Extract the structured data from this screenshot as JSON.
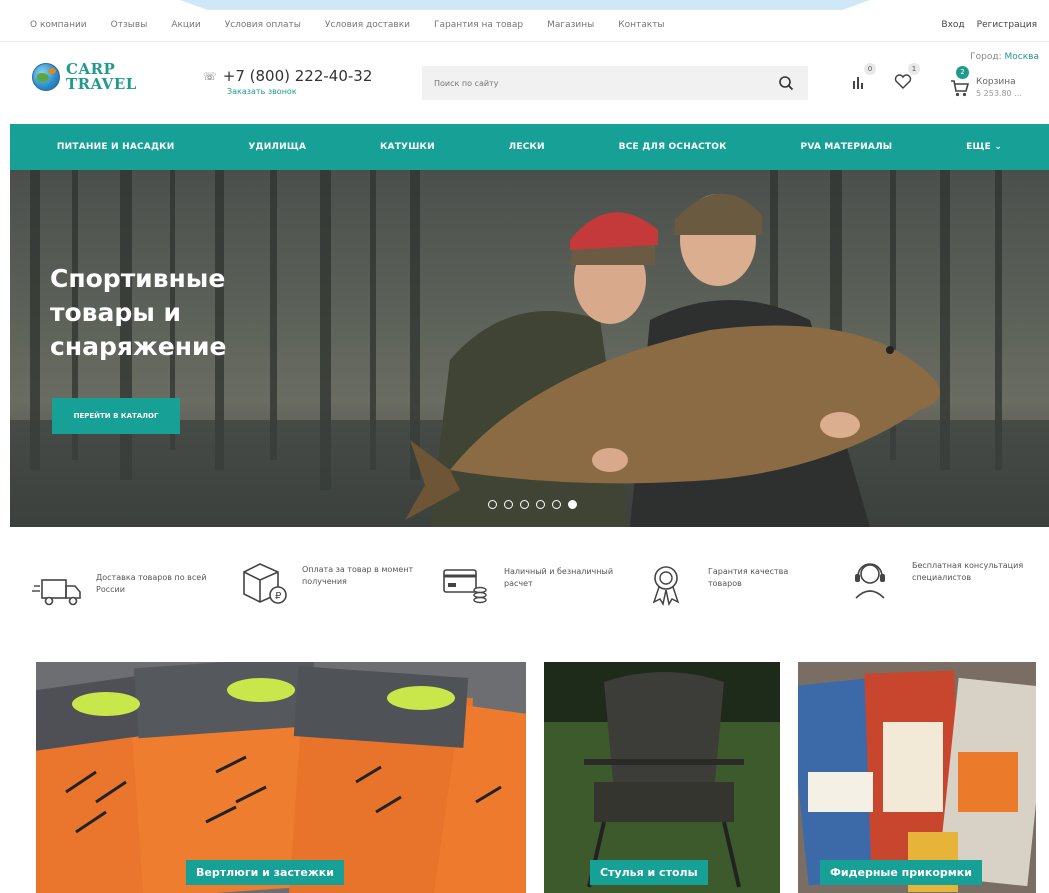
{
  "topbar": {
    "links": [
      "О компании",
      "Отзывы",
      "Акции",
      "Условия оплаты",
      "Условия доставки",
      "Гарантия на товар",
      "Магазины",
      "Контакты"
    ],
    "login": "Вход",
    "register": "Регистрация"
  },
  "header": {
    "logo_line1": "CARP",
    "logo_line2": "TRAVEL",
    "phone": "+7 (800) 222-40-32",
    "callback": "Заказать звонок",
    "search_placeholder": "Поиск по сайту",
    "compare_count": "0",
    "wishlist_count": "1",
    "city_label": "Город:",
    "city_value": "Москва",
    "cart_label": "Корзина",
    "cart_sum": "5 253.80 ...",
    "cart_count": "2"
  },
  "nav": {
    "items": [
      "ПИТАНИЕ И НАСАДКИ",
      "УДИЛИЩА",
      "КАТУШКИ",
      "ЛЕСКИ",
      "ВСЕ ДЛЯ ОСНАСТОК",
      "PVA МАТЕРИАЛЫ",
      "ЕЩЕ ⌄"
    ]
  },
  "hero": {
    "title": "Спортивные товары и снаряжение",
    "cta": "ПЕРЕЙТИ В КАТАЛОГ",
    "slide_count": 6,
    "active_slide": 6
  },
  "features": [
    {
      "icon": "truck-icon",
      "text": "Доставка товаров по всей России"
    },
    {
      "icon": "box-icon",
      "text": "Оплата за товар в момент получения"
    },
    {
      "icon": "card-payment-icon",
      "text": "Наличный и безналичный расчет"
    },
    {
      "icon": "award-icon",
      "text": "Гарантия качества товаров"
    },
    {
      "icon": "headset-icon",
      "text": "Бесплатная консультация специалистов"
    }
  ],
  "categories": [
    {
      "label": "Вертлюги и застежки"
    },
    {
      "label": "Стулья и столы"
    },
    {
      "label": "Фидерные прикормки"
    }
  ],
  "colors": {
    "accent": "#17a096",
    "text": "#333333"
  }
}
